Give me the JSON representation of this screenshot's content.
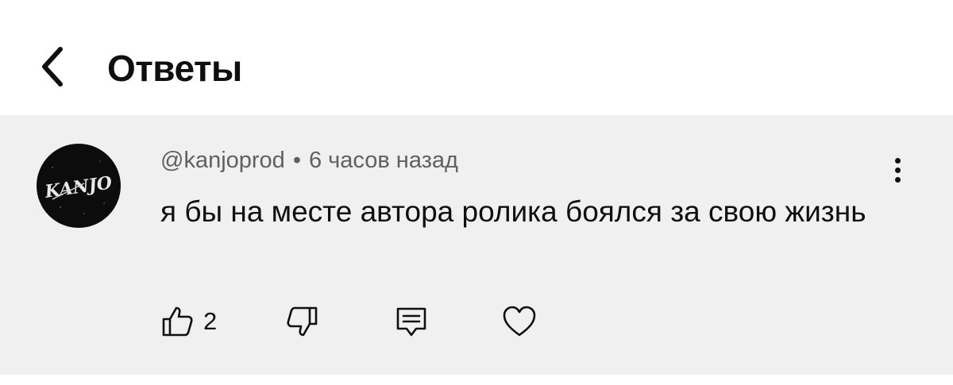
{
  "header": {
    "title": "Ответы",
    "back_icon": "chevron-left-icon"
  },
  "comment": {
    "author": "@kanjoprod",
    "separator": "•",
    "time": "6 часов назад",
    "text": "я бы на месте автора ролика боялся за свою жизнь",
    "avatar_text": "KANJO",
    "like_count": "2",
    "icons": {
      "like": "thumb-up-icon",
      "dislike": "thumb-down-icon",
      "reply": "reply-icon",
      "heart": "heart-icon",
      "more": "more-vertical-icon"
    }
  },
  "colors": {
    "header_bg": "#ffffff",
    "comment_bg": "#f0f0f0",
    "text": "#0f0f0f",
    "meta_text": "#606060",
    "avatar_bg": "#0c0c0c"
  }
}
